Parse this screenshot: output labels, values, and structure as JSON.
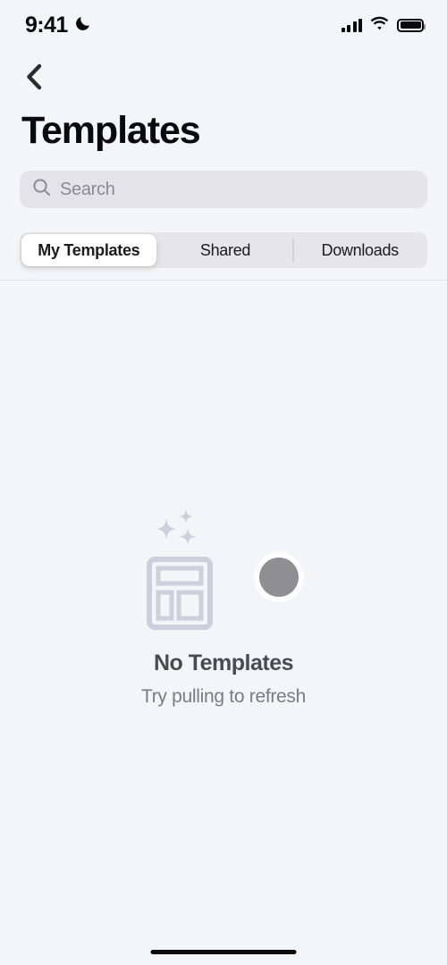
{
  "status_bar": {
    "time": "9:41",
    "dnd_icon": "moon-icon",
    "cellular_icon": "cellular-signal-icon",
    "wifi_icon": "wifi-icon",
    "battery_icon": "battery-full-icon"
  },
  "nav": {
    "back_icon": "chevron-left-icon",
    "title": "Templates"
  },
  "search": {
    "icon": "search-icon",
    "placeholder": "Search",
    "value": ""
  },
  "tabs": {
    "items": [
      {
        "label": "My Templates",
        "selected": true
      },
      {
        "label": "Shared",
        "selected": false
      },
      {
        "label": "Downloads",
        "selected": false
      }
    ]
  },
  "empty_state": {
    "illustration_icon": "template-layout-icon",
    "sparkles_icon": "sparkles-icon",
    "refresh_spinner_icon": "refresh-spinner-puck",
    "title": "No Templates",
    "subtitle": "Try pulling to refresh"
  },
  "home_indicator": "home-indicator",
  "colors": {
    "background": "#f4f5f7",
    "search_fill": "#e3e3e8",
    "segment_track": "#e5e5ea",
    "segment_active": "#ffffff",
    "text_primary": "#0a0a0c",
    "text_secondary": "#7b7b82",
    "illustration": "#ccd0dc",
    "spinner": "#8e8e93"
  }
}
